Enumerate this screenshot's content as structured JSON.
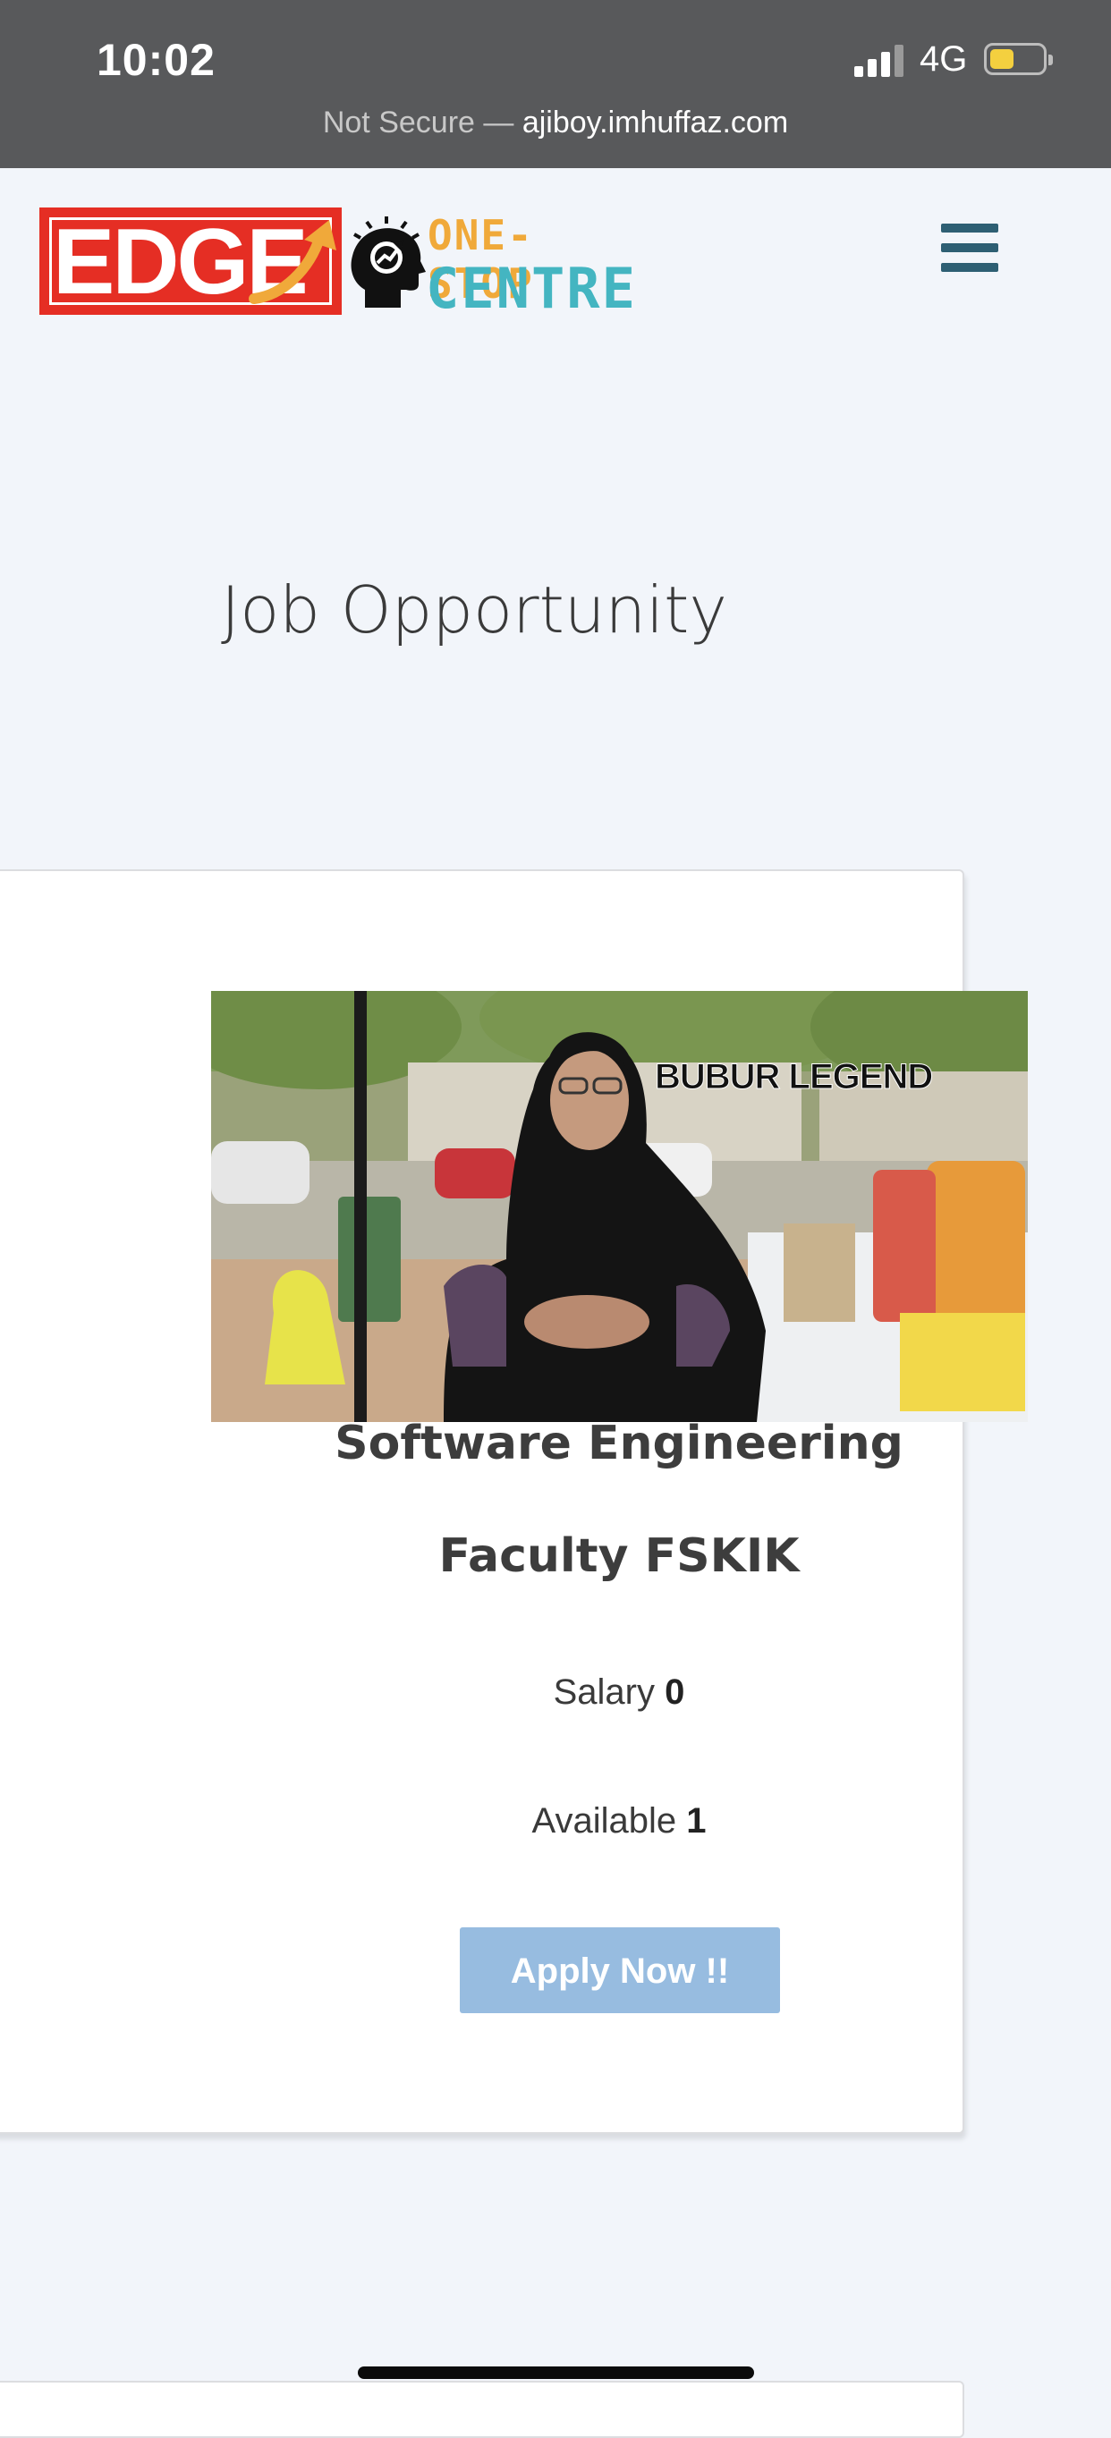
{
  "status_bar": {
    "time": "10:02",
    "network": "4G",
    "battery_level": 0.45
  },
  "address_bar": {
    "security_text": "Not Secure —",
    "host": "ajiboy.imhuffaz.com"
  },
  "header": {
    "logo": {
      "edge_text": "EDGE",
      "line1": "ONE-STOP",
      "line2": "CENTRE"
    },
    "menu_icon": "hamburger-icon"
  },
  "page": {
    "title": "Job Opportunity"
  },
  "job": {
    "photo_caption": "BUBUR LEGEND",
    "title": "Software Engineering",
    "faculty": "Faculty FSKIK",
    "salary_label": "Salary",
    "salary_value": "0",
    "available_label": "Available",
    "available_value": "1",
    "apply_label": "Apply Now !!"
  },
  "colors": {
    "status_bar_bg": "#58595b",
    "page_bg": "#f2f5fa",
    "logo_red": "#e52e24",
    "logo_orange": "#f0a93a",
    "logo_teal": "#44b5c1",
    "menu_icon": "#2e5f73",
    "apply_button": "#97bce0"
  }
}
